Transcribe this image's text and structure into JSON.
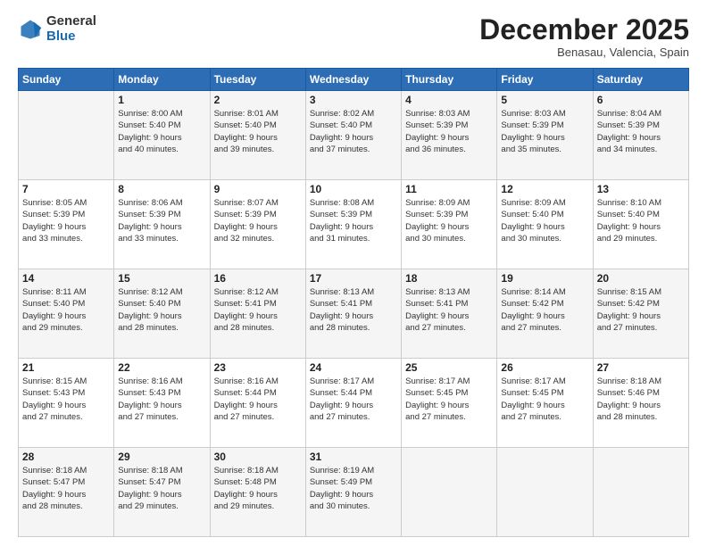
{
  "header": {
    "logo_general": "General",
    "logo_blue": "Blue",
    "month_title": "December 2025",
    "location": "Benasau, Valencia, Spain"
  },
  "days_of_week": [
    "Sunday",
    "Monday",
    "Tuesday",
    "Wednesday",
    "Thursday",
    "Friday",
    "Saturday"
  ],
  "weeks": [
    [
      {
        "day": "",
        "info": ""
      },
      {
        "day": "1",
        "info": "Sunrise: 8:00 AM\nSunset: 5:40 PM\nDaylight: 9 hours\nand 40 minutes."
      },
      {
        "day": "2",
        "info": "Sunrise: 8:01 AM\nSunset: 5:40 PM\nDaylight: 9 hours\nand 39 minutes."
      },
      {
        "day": "3",
        "info": "Sunrise: 8:02 AM\nSunset: 5:40 PM\nDaylight: 9 hours\nand 37 minutes."
      },
      {
        "day": "4",
        "info": "Sunrise: 8:03 AM\nSunset: 5:39 PM\nDaylight: 9 hours\nand 36 minutes."
      },
      {
        "day": "5",
        "info": "Sunrise: 8:03 AM\nSunset: 5:39 PM\nDaylight: 9 hours\nand 35 minutes."
      },
      {
        "day": "6",
        "info": "Sunrise: 8:04 AM\nSunset: 5:39 PM\nDaylight: 9 hours\nand 34 minutes."
      }
    ],
    [
      {
        "day": "7",
        "info": "Sunrise: 8:05 AM\nSunset: 5:39 PM\nDaylight: 9 hours\nand 33 minutes."
      },
      {
        "day": "8",
        "info": "Sunrise: 8:06 AM\nSunset: 5:39 PM\nDaylight: 9 hours\nand 33 minutes."
      },
      {
        "day": "9",
        "info": "Sunrise: 8:07 AM\nSunset: 5:39 PM\nDaylight: 9 hours\nand 32 minutes."
      },
      {
        "day": "10",
        "info": "Sunrise: 8:08 AM\nSunset: 5:39 PM\nDaylight: 9 hours\nand 31 minutes."
      },
      {
        "day": "11",
        "info": "Sunrise: 8:09 AM\nSunset: 5:39 PM\nDaylight: 9 hours\nand 30 minutes."
      },
      {
        "day": "12",
        "info": "Sunrise: 8:09 AM\nSunset: 5:40 PM\nDaylight: 9 hours\nand 30 minutes."
      },
      {
        "day": "13",
        "info": "Sunrise: 8:10 AM\nSunset: 5:40 PM\nDaylight: 9 hours\nand 29 minutes."
      }
    ],
    [
      {
        "day": "14",
        "info": "Sunrise: 8:11 AM\nSunset: 5:40 PM\nDaylight: 9 hours\nand 29 minutes."
      },
      {
        "day": "15",
        "info": "Sunrise: 8:12 AM\nSunset: 5:40 PM\nDaylight: 9 hours\nand 28 minutes."
      },
      {
        "day": "16",
        "info": "Sunrise: 8:12 AM\nSunset: 5:41 PM\nDaylight: 9 hours\nand 28 minutes."
      },
      {
        "day": "17",
        "info": "Sunrise: 8:13 AM\nSunset: 5:41 PM\nDaylight: 9 hours\nand 28 minutes."
      },
      {
        "day": "18",
        "info": "Sunrise: 8:13 AM\nSunset: 5:41 PM\nDaylight: 9 hours\nand 27 minutes."
      },
      {
        "day": "19",
        "info": "Sunrise: 8:14 AM\nSunset: 5:42 PM\nDaylight: 9 hours\nand 27 minutes."
      },
      {
        "day": "20",
        "info": "Sunrise: 8:15 AM\nSunset: 5:42 PM\nDaylight: 9 hours\nand 27 minutes."
      }
    ],
    [
      {
        "day": "21",
        "info": "Sunrise: 8:15 AM\nSunset: 5:43 PM\nDaylight: 9 hours\nand 27 minutes."
      },
      {
        "day": "22",
        "info": "Sunrise: 8:16 AM\nSunset: 5:43 PM\nDaylight: 9 hours\nand 27 minutes."
      },
      {
        "day": "23",
        "info": "Sunrise: 8:16 AM\nSunset: 5:44 PM\nDaylight: 9 hours\nand 27 minutes."
      },
      {
        "day": "24",
        "info": "Sunrise: 8:17 AM\nSunset: 5:44 PM\nDaylight: 9 hours\nand 27 minutes."
      },
      {
        "day": "25",
        "info": "Sunrise: 8:17 AM\nSunset: 5:45 PM\nDaylight: 9 hours\nand 27 minutes."
      },
      {
        "day": "26",
        "info": "Sunrise: 8:17 AM\nSunset: 5:45 PM\nDaylight: 9 hours\nand 27 minutes."
      },
      {
        "day": "27",
        "info": "Sunrise: 8:18 AM\nSunset: 5:46 PM\nDaylight: 9 hours\nand 28 minutes."
      }
    ],
    [
      {
        "day": "28",
        "info": "Sunrise: 8:18 AM\nSunset: 5:47 PM\nDaylight: 9 hours\nand 28 minutes."
      },
      {
        "day": "29",
        "info": "Sunrise: 8:18 AM\nSunset: 5:47 PM\nDaylight: 9 hours\nand 29 minutes."
      },
      {
        "day": "30",
        "info": "Sunrise: 8:18 AM\nSunset: 5:48 PM\nDaylight: 9 hours\nand 29 minutes."
      },
      {
        "day": "31",
        "info": "Sunrise: 8:19 AM\nSunset: 5:49 PM\nDaylight: 9 hours\nand 30 minutes."
      },
      {
        "day": "",
        "info": ""
      },
      {
        "day": "",
        "info": ""
      },
      {
        "day": "",
        "info": ""
      }
    ]
  ]
}
